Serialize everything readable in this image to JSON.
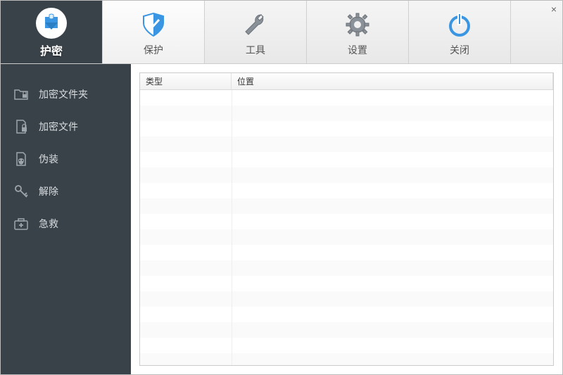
{
  "window": {
    "close_symbol": "×"
  },
  "topbar": {
    "items": [
      {
        "key": "humi",
        "label": "护密"
      },
      {
        "key": "protect",
        "label": "保护"
      },
      {
        "key": "tools",
        "label": "工具"
      },
      {
        "key": "settings",
        "label": "设置"
      },
      {
        "key": "close",
        "label": "关闭"
      }
    ]
  },
  "sidebar": {
    "items": [
      {
        "key": "encrypt-folder",
        "label": "加密文件夹"
      },
      {
        "key": "encrypt-file",
        "label": "加密文件"
      },
      {
        "key": "disguise",
        "label": "伪装"
      },
      {
        "key": "release",
        "label": "解除"
      },
      {
        "key": "rescue",
        "label": "急救"
      }
    ]
  },
  "table": {
    "columns": {
      "type": "类型",
      "location": "位置"
    },
    "rows": []
  }
}
